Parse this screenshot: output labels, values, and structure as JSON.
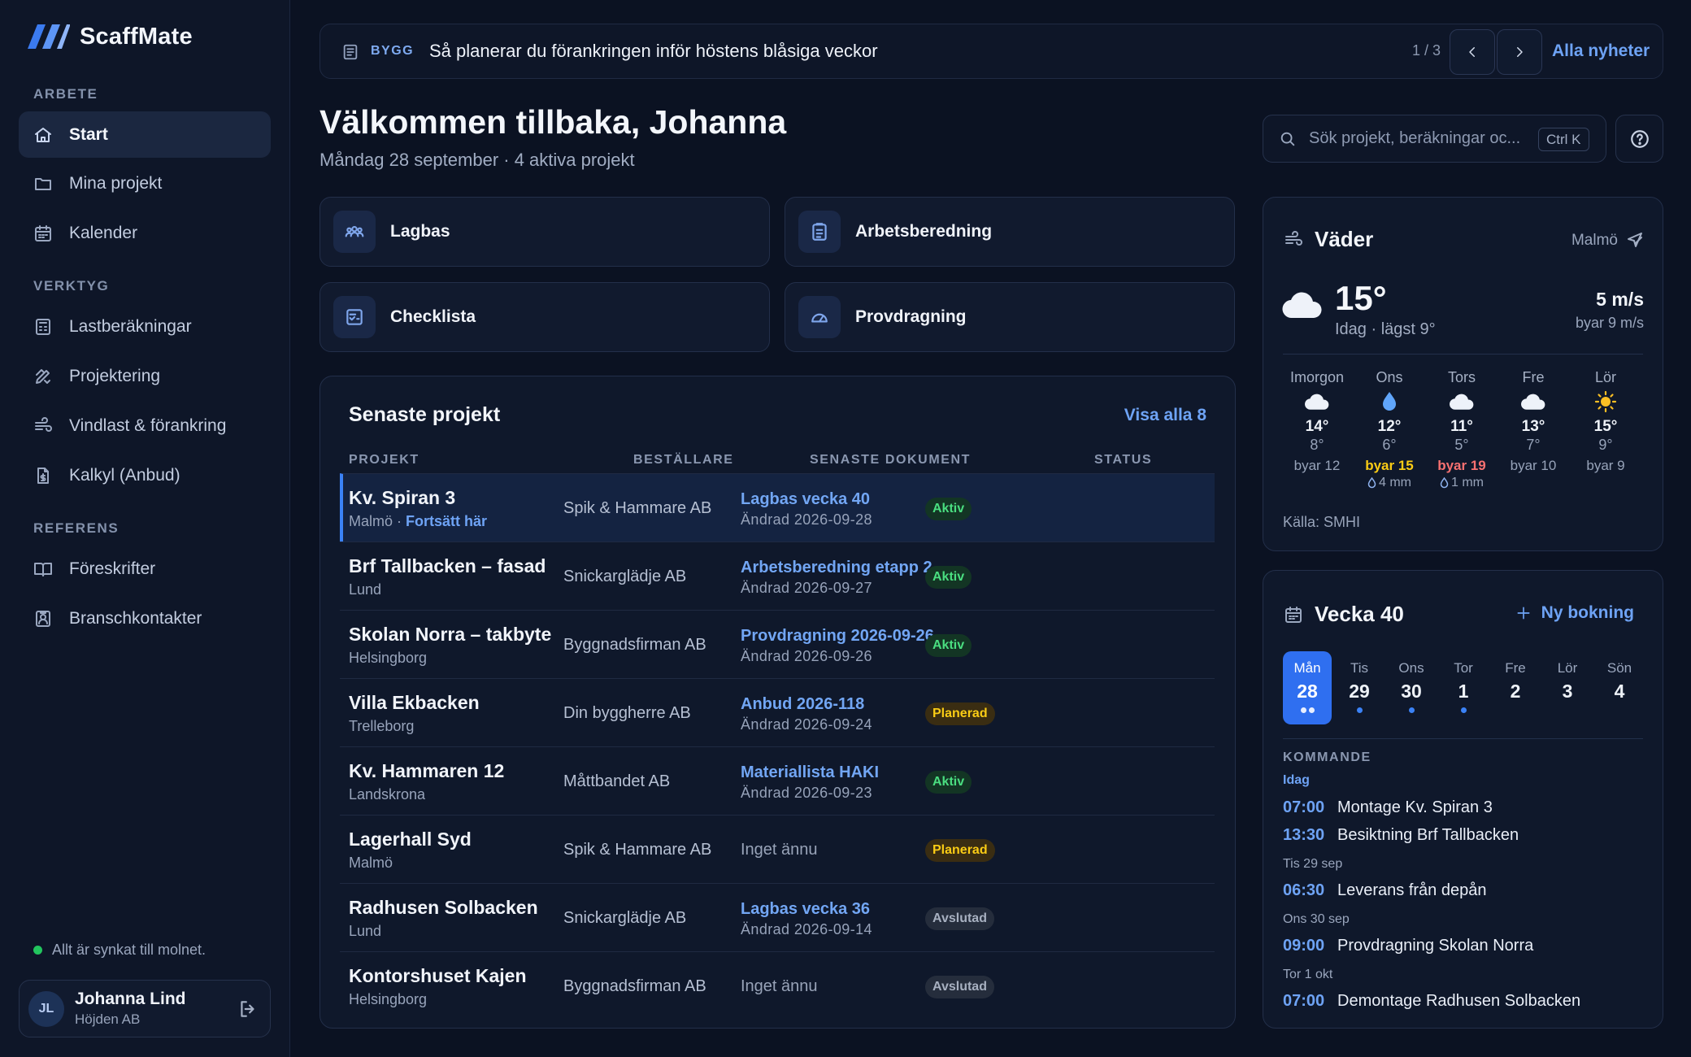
{
  "app": {
    "name": "ScaffMate",
    "accent": "#3b82f6"
  },
  "sidebar": {
    "sections": [
      {
        "title": "ARBETE",
        "items": [
          {
            "label": "Start",
            "icon": "home-icon",
            "active": true
          },
          {
            "label": "Mina projekt",
            "icon": "folder-icon"
          },
          {
            "label": "Kalender",
            "icon": "calendar-icon"
          }
        ]
      },
      {
        "title": "VERKTYG",
        "items": [
          {
            "label": "Lastberäkningar",
            "icon": "calculator-icon"
          },
          {
            "label": "Projektering",
            "icon": "ruler-pencil-icon"
          },
          {
            "label": "Vindlast & förankring",
            "icon": "wind-icon"
          },
          {
            "label": "Kalkyl (Anbud)",
            "icon": "document-dollar-icon"
          }
        ]
      },
      {
        "title": "REFERENS",
        "items": [
          {
            "label": "Föreskrifter",
            "icon": "book-icon"
          },
          {
            "label": "Branschkontakter",
            "icon": "contact-card-icon"
          }
        ]
      }
    ],
    "sync_status": "Allt är synkat till molnet.",
    "user": {
      "initials": "JL",
      "name": "Johanna Lind",
      "org": "Höjden AB"
    }
  },
  "news": {
    "tag": "BYGG",
    "title": "Så planerar du förankringen inför höstens blåsiga veckor",
    "count": "1 / 3",
    "all_label": "Alla nyheter"
  },
  "header": {
    "title": "Välkommen tillbaka, Johanna",
    "subtitle": "Måndag 28 september · 4 aktiva projekt",
    "search_placeholder": "Sök projekt, beräkningar oc...",
    "search_shortcut": "Ctrl K"
  },
  "quick_actions": [
    {
      "label": "Lagbas",
      "icon": "team-icon"
    },
    {
      "label": "Arbetsberedning",
      "icon": "clipboard-icon"
    },
    {
      "label": "Checklista",
      "icon": "checklist-icon"
    },
    {
      "label": "Provdragning",
      "icon": "gauge-icon"
    }
  ],
  "projects": {
    "title": "Senaste projekt",
    "view_all": "Visa alla 8",
    "columns": [
      "PROJEKT",
      "BESTÄLLARE",
      "SENASTE DOKUMENT",
      "STATUS"
    ],
    "continue_label": "Fortsätt här",
    "rows": [
      {
        "name": "Kv. Spiran 3",
        "city": "Malmö",
        "client": "Spik & Hammare AB",
        "doc": "Lagbas vecka 40",
        "date": "Ändrad 2026-09-28",
        "status": "Aktiv",
        "highlight": true
      },
      {
        "name": "Brf Tallbacken – fasad",
        "city": "Lund",
        "client": "Snickarglädje AB",
        "doc": "Arbetsberedning etapp 2",
        "date": "Ändrad 2026-09-27",
        "status": "Aktiv"
      },
      {
        "name": "Skolan Norra – takbyte",
        "city": "Helsingborg",
        "client": "Byggnadsfirman AB",
        "doc": "Provdragning 2026-09-26",
        "date": "Ändrad 2026-09-26",
        "status": "Aktiv"
      },
      {
        "name": "Villa Ekbacken",
        "city": "Trelleborg",
        "client": "Din byggherre AB",
        "doc": "Anbud 2026-118",
        "date": "Ändrad 2026-09-24",
        "status": "Planerad"
      },
      {
        "name": "Kv. Hammaren 12",
        "city": "Landskrona",
        "client": "Måttbandet AB",
        "doc": "Materiallista HAKI",
        "date": "Ändrad 2026-09-23",
        "status": "Aktiv"
      },
      {
        "name": "Lagerhall Syd",
        "city": "Malmö",
        "client": "Spik & Hammare AB",
        "doc": "",
        "date": "",
        "none": "Inget ännu",
        "status": "Planerad"
      },
      {
        "name": "Radhusen Solbacken",
        "city": "Lund",
        "client": "Snickarglädje AB",
        "doc": "Lagbas vecka 36",
        "date": "Ändrad 2026-09-14",
        "status": "Avslutad"
      },
      {
        "name": "Kontorshuset Kajen",
        "city": "Helsingborg",
        "client": "Byggnadsfirman AB",
        "doc": "",
        "date": "",
        "none": "Inget ännu",
        "status": "Avslutad"
      }
    ]
  },
  "weather": {
    "title": "Väder",
    "location": "Malmö",
    "temp": "15°",
    "today": "Idag · lägst 9°",
    "wind": "5 m/s",
    "gust": "byar 9 m/s",
    "forecast": [
      {
        "day": "Imorgon",
        "icon": "cloud-icon",
        "hi": "14°",
        "lo": "8°",
        "gust": "byar 12",
        "level": ""
      },
      {
        "day": "Ons",
        "icon": "raindrop-icon",
        "hi": "12°",
        "lo": "6°",
        "gust": "byar 15",
        "level": "warn-y",
        "rain": "4 mm"
      },
      {
        "day": "Tors",
        "icon": "cloud-icon",
        "hi": "11°",
        "lo": "5°",
        "gust": "byar 19",
        "level": "warn-r",
        "rain": "1 mm"
      },
      {
        "day": "Fre",
        "icon": "cloud-icon",
        "hi": "13°",
        "lo": "7°",
        "gust": "byar 10",
        "level": ""
      },
      {
        "day": "Lör",
        "icon": "sun-icon",
        "hi": "15°",
        "lo": "9°",
        "gust": "byar 9",
        "level": ""
      }
    ],
    "source": "Källa: SMHI"
  },
  "week": {
    "title": "Vecka 40",
    "book_label": "Ny bokning",
    "days": [
      {
        "name": "Mån",
        "num": "28",
        "dots": 2,
        "selected": true
      },
      {
        "name": "Tis",
        "num": "29",
        "dots": 1
      },
      {
        "name": "Ons",
        "num": "30",
        "dots": 1
      },
      {
        "name": "Tor",
        "num": "1",
        "dots": 1
      },
      {
        "name": "Fre",
        "num": "2",
        "dots": 0
      },
      {
        "name": "Lör",
        "num": "3",
        "dots": 0
      },
      {
        "name": "Sön",
        "num": "4",
        "dots": 0
      }
    ],
    "upcoming_title": "KOMMANDE",
    "upcoming": [
      {
        "day": "Idag",
        "today": true,
        "events": [
          {
            "time": "07:00",
            "title": "Montage Kv. Spiran 3"
          },
          {
            "time": "13:30",
            "title": "Besiktning Brf Tallbacken"
          }
        ]
      },
      {
        "day": "Tis 29 sep",
        "events": [
          {
            "time": "06:30",
            "title": "Leverans från depån"
          }
        ]
      },
      {
        "day": "Ons 30 sep",
        "events": [
          {
            "time": "09:00",
            "title": "Provdragning Skolan Norra"
          }
        ]
      },
      {
        "day": "Tor 1 okt",
        "events": [
          {
            "time": "07:00",
            "title": "Demontage Radhusen Solbacken"
          }
        ]
      }
    ]
  }
}
